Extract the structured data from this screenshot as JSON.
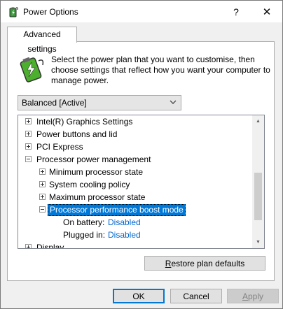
{
  "window": {
    "title": "Power Options",
    "help_label": "?",
    "close_label": "✕"
  },
  "tabs": [
    {
      "label": "Advanced settings",
      "active": true
    }
  ],
  "description": "Select the power plan that you want to customise, then choose settings that reflect how you want your computer to manage power.",
  "plan_dropdown": {
    "selected": "Balanced [Active]"
  },
  "tree": {
    "items": [
      {
        "label": "Intel(R) Graphics Settings",
        "expander": "plus"
      },
      {
        "label": "Power buttons and lid",
        "expander": "plus"
      },
      {
        "label": "PCI Express",
        "expander": "plus"
      },
      {
        "label": "Processor power management",
        "expander": "minus"
      },
      {
        "label": "Minimum processor state",
        "expander": "plus"
      },
      {
        "label": "System cooling policy",
        "expander": "plus"
      },
      {
        "label": "Maximum processor state",
        "expander": "plus"
      },
      {
        "label": "Processor performance boost mode",
        "expander": "minus",
        "selected": true
      },
      {
        "label": "On battery:",
        "value": "Disabled"
      },
      {
        "label": "Plugged in:",
        "value": "Disabled"
      },
      {
        "label": "Display",
        "expander": "plus"
      }
    ]
  },
  "buttons": {
    "restore_prefix": "R",
    "restore_rest": "estore plan defaults",
    "ok": "OK",
    "cancel": "Cancel",
    "apply_prefix": "A",
    "apply_rest": "pply"
  },
  "colors": {
    "selection": "#0078d7",
    "link": "#0066cc"
  }
}
